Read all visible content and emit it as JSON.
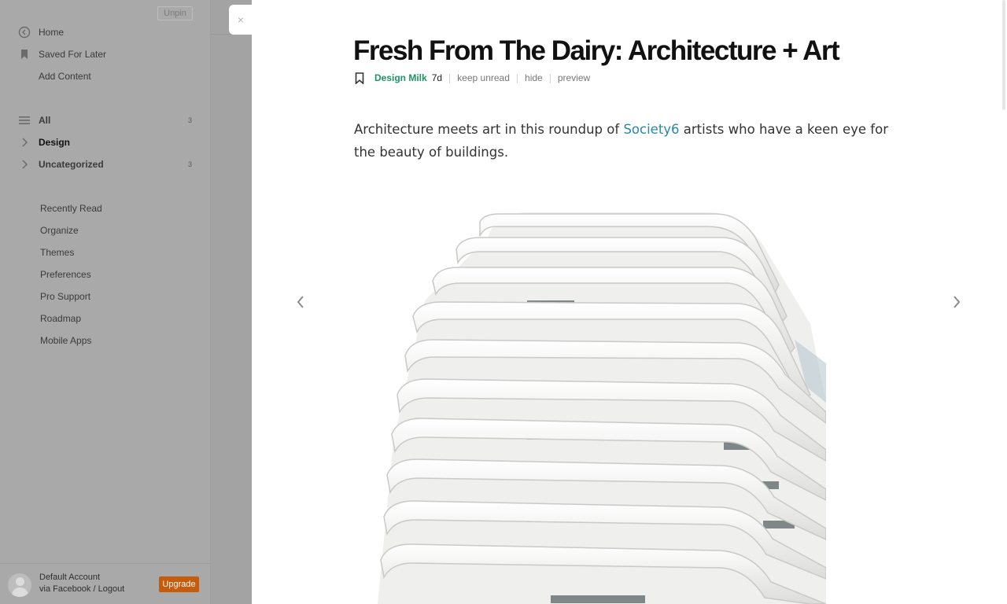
{
  "sidebar": {
    "unpin_label": "Unpin",
    "nav": [
      {
        "label": "Home",
        "icon": "home-icon"
      },
      {
        "label": "Saved For Later",
        "icon": "bookmark-icon"
      },
      {
        "label": "Add Content",
        "icon": ""
      }
    ],
    "feeds": [
      {
        "label": "All",
        "count": "3",
        "icon": "list-icon"
      },
      {
        "label": "Design",
        "count": "",
        "icon": "chevron-right-icon",
        "active": true
      },
      {
        "label": "Uncategorized",
        "count": "3",
        "icon": "chevron-right-icon"
      }
    ],
    "links": [
      "Recently Read",
      "Organize",
      "Themes",
      "Preferences",
      "Pro Support",
      "Roadmap",
      "Mobile Apps"
    ],
    "account": {
      "name": "Default Account",
      "sub": "via Facebook / Logout",
      "upgrade_label": "Upgrade"
    }
  },
  "close_label": "×",
  "article": {
    "title": "Fresh From The Dairy: Architecture + Art",
    "source": "Design Milk",
    "age": "7d",
    "actions": [
      "keep unread",
      "hide",
      "preview"
    ],
    "lede_before": "Architecture meets art in this roundup of ",
    "lede_link": "Society6",
    "lede_after": " artists who have a keen eye for the beauty of buildings."
  },
  "colors": {
    "accent_source": "#1e9466",
    "link": "#2a86a3",
    "upgrade": "#c65b0c"
  }
}
